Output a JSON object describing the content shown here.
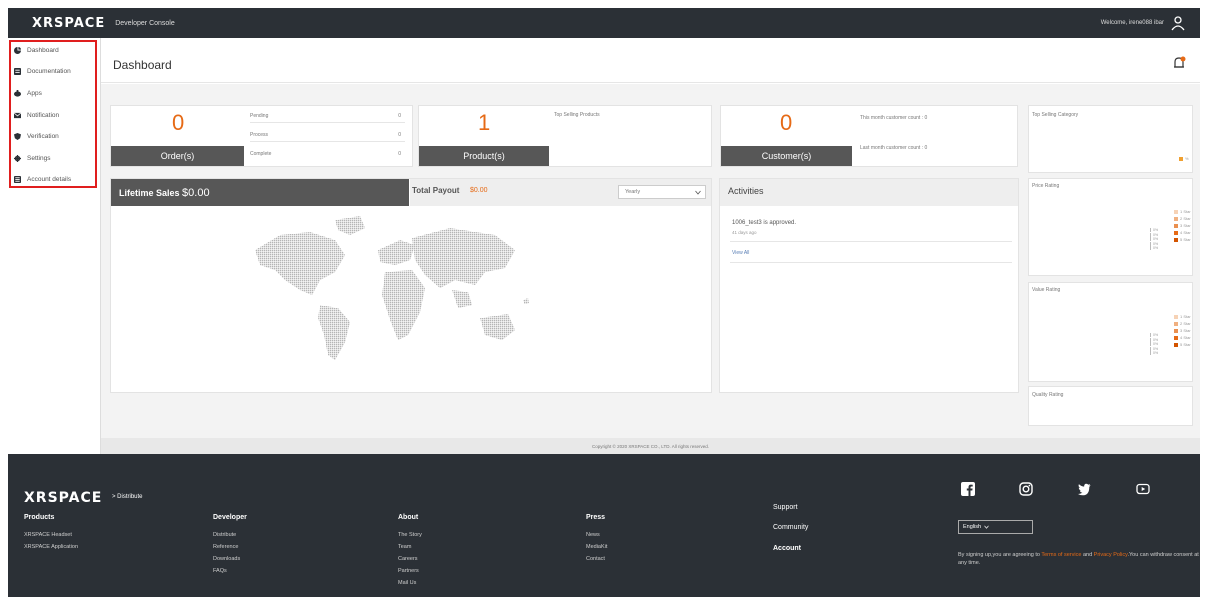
{
  "topbar": {
    "logo": "XRSPACE",
    "console": "Developer Console",
    "welcome": "Welcome, irene088 ibar"
  },
  "sidebar": {
    "items": [
      {
        "label": "Dashboard",
        "icon": "pie-chart-icon"
      },
      {
        "label": "Documentation",
        "icon": "document-icon"
      },
      {
        "label": "Apps",
        "icon": "apps-icon"
      },
      {
        "label": "Notification",
        "icon": "mail-icon"
      },
      {
        "label": "Verification",
        "icon": "shield-icon"
      },
      {
        "label": "Settings",
        "icon": "gear-icon"
      },
      {
        "label": "Account details",
        "icon": "account-icon"
      }
    ]
  },
  "header": {
    "title": "Dashboard"
  },
  "orders": {
    "count": "0",
    "label": "Order(s)",
    "rows": [
      {
        "name": "Pending",
        "value": "0"
      },
      {
        "name": "Process",
        "value": "0"
      },
      {
        "name": "Complete",
        "value": "0"
      }
    ]
  },
  "products": {
    "count": "1",
    "label": "Product(s)",
    "top_link": "Top Selling Products"
  },
  "customers": {
    "count": "0",
    "label": "Customer(s)",
    "this_month": "This month customer count : 0",
    "last_month": "Last month customer count : 0"
  },
  "sales": {
    "lifetime_label": "Lifetime Sales",
    "lifetime_value": "$0.00",
    "payout_label": "Total Payout",
    "payout_value": "$0.00",
    "period": "Yearly"
  },
  "activities": {
    "title": "Activities",
    "item": "1006_test3 is approved.",
    "item_time": "41 days ago",
    "view_all": "View All"
  },
  "right": {
    "top_category": "Top Selling Category",
    "percent": "%",
    "price_rating": "Price Rating",
    "value_rating": "Value Rating",
    "quality_rating": "Quality Rating",
    "legend": [
      "1 Star",
      "2 Star",
      "3 Star",
      "4 Star",
      "5 Star"
    ],
    "legend_colors": [
      "#f6d2b5",
      "#f0b080",
      "#ea9050",
      "#e66a16",
      "#d35400"
    ],
    "pct": [
      "0%",
      "0%",
      "0%",
      "0%",
      "0%"
    ]
  },
  "copyright": "Copyright © 2020 XRSPACE CO., LTD. All rights reserved.",
  "footer": {
    "logo": "XRSPACE",
    "distribute": "> Distribute",
    "products": {
      "h": "Products",
      "links": [
        "XRSPACE Headset",
        "XRSPACE Application"
      ]
    },
    "developer": {
      "h": "Developer",
      "links": [
        "Distribute",
        "Reference",
        "Downloads",
        "FAQs"
      ]
    },
    "about": {
      "h": "About",
      "links": [
        "The Story",
        "Team",
        "Careers",
        "Partners",
        "Mail Us"
      ]
    },
    "press": {
      "h": "Press",
      "links": [
        "News",
        "MediaKit",
        "Contact"
      ]
    },
    "support": [
      "Support",
      "Community",
      "Account"
    ],
    "language": "English",
    "consent_pre": "By signing up,you are agreeing to ",
    "terms": "Terms of service",
    "and": " and ",
    "privacy": "Privacy Policy",
    "consent_post": ".You can withdraw consent at any time."
  }
}
